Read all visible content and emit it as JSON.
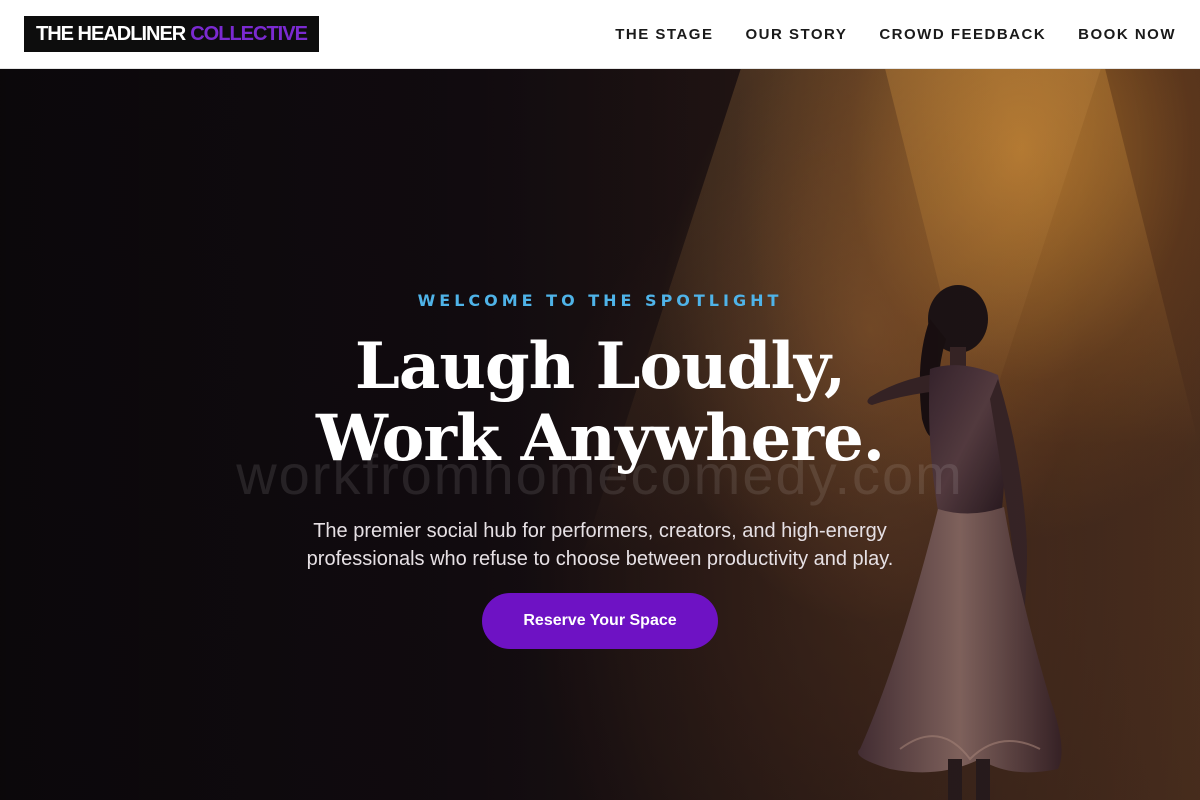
{
  "header": {
    "logo": {
      "primary": "THE HEADLINER",
      "accent": "COLLECTIVE"
    },
    "nav": [
      {
        "label": "THE STAGE"
      },
      {
        "label": "OUR STORY"
      },
      {
        "label": "CROWD FEEDBACK"
      },
      {
        "label": "BOOK NOW"
      }
    ]
  },
  "hero": {
    "eyebrow": "WELCOME TO THE SPOTLIGHT",
    "headline": {
      "line1": "Laugh Loudly,",
      "line2": "Work Anywhere."
    },
    "subtext": {
      "line1": "The premier social hub for performers, creators, and high-energy",
      "line2": "professionals who refuse to choose between productivity and play."
    },
    "cta_label": "Reserve Your Space",
    "watermark": "workfromhomecomedy.com",
    "background_image": "performer-on-stage-under-spotlight"
  },
  "colors": {
    "accent_purple": "#6e12c4",
    "logo_accent": "#7b2ad1",
    "eyebrow_blue": "#4fb3e8",
    "logo_bg": "#0d0d0d"
  }
}
